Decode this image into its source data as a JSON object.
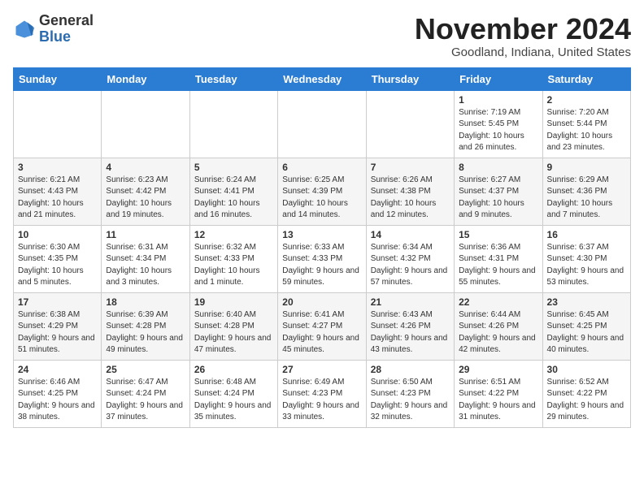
{
  "header": {
    "logo_general": "General",
    "logo_blue": "Blue",
    "month_title": "November 2024",
    "location": "Goodland, Indiana, United States"
  },
  "weekdays": [
    "Sunday",
    "Monday",
    "Tuesday",
    "Wednesday",
    "Thursday",
    "Friday",
    "Saturday"
  ],
  "weeks": [
    [
      {
        "day": "",
        "info": ""
      },
      {
        "day": "",
        "info": ""
      },
      {
        "day": "",
        "info": ""
      },
      {
        "day": "",
        "info": ""
      },
      {
        "day": "",
        "info": ""
      },
      {
        "day": "1",
        "info": "Sunrise: 7:19 AM\nSunset: 5:45 PM\nDaylight: 10 hours and 26 minutes."
      },
      {
        "day": "2",
        "info": "Sunrise: 7:20 AM\nSunset: 5:44 PM\nDaylight: 10 hours and 23 minutes."
      }
    ],
    [
      {
        "day": "3",
        "info": "Sunrise: 6:21 AM\nSunset: 4:43 PM\nDaylight: 10 hours and 21 minutes."
      },
      {
        "day": "4",
        "info": "Sunrise: 6:23 AM\nSunset: 4:42 PM\nDaylight: 10 hours and 19 minutes."
      },
      {
        "day": "5",
        "info": "Sunrise: 6:24 AM\nSunset: 4:41 PM\nDaylight: 10 hours and 16 minutes."
      },
      {
        "day": "6",
        "info": "Sunrise: 6:25 AM\nSunset: 4:39 PM\nDaylight: 10 hours and 14 minutes."
      },
      {
        "day": "7",
        "info": "Sunrise: 6:26 AM\nSunset: 4:38 PM\nDaylight: 10 hours and 12 minutes."
      },
      {
        "day": "8",
        "info": "Sunrise: 6:27 AM\nSunset: 4:37 PM\nDaylight: 10 hours and 9 minutes."
      },
      {
        "day": "9",
        "info": "Sunrise: 6:29 AM\nSunset: 4:36 PM\nDaylight: 10 hours and 7 minutes."
      }
    ],
    [
      {
        "day": "10",
        "info": "Sunrise: 6:30 AM\nSunset: 4:35 PM\nDaylight: 10 hours and 5 minutes."
      },
      {
        "day": "11",
        "info": "Sunrise: 6:31 AM\nSunset: 4:34 PM\nDaylight: 10 hours and 3 minutes."
      },
      {
        "day": "12",
        "info": "Sunrise: 6:32 AM\nSunset: 4:33 PM\nDaylight: 10 hours and 1 minute."
      },
      {
        "day": "13",
        "info": "Sunrise: 6:33 AM\nSunset: 4:33 PM\nDaylight: 9 hours and 59 minutes."
      },
      {
        "day": "14",
        "info": "Sunrise: 6:34 AM\nSunset: 4:32 PM\nDaylight: 9 hours and 57 minutes."
      },
      {
        "day": "15",
        "info": "Sunrise: 6:36 AM\nSunset: 4:31 PM\nDaylight: 9 hours and 55 minutes."
      },
      {
        "day": "16",
        "info": "Sunrise: 6:37 AM\nSunset: 4:30 PM\nDaylight: 9 hours and 53 minutes."
      }
    ],
    [
      {
        "day": "17",
        "info": "Sunrise: 6:38 AM\nSunset: 4:29 PM\nDaylight: 9 hours and 51 minutes."
      },
      {
        "day": "18",
        "info": "Sunrise: 6:39 AM\nSunset: 4:28 PM\nDaylight: 9 hours and 49 minutes."
      },
      {
        "day": "19",
        "info": "Sunrise: 6:40 AM\nSunset: 4:28 PM\nDaylight: 9 hours and 47 minutes."
      },
      {
        "day": "20",
        "info": "Sunrise: 6:41 AM\nSunset: 4:27 PM\nDaylight: 9 hours and 45 minutes."
      },
      {
        "day": "21",
        "info": "Sunrise: 6:43 AM\nSunset: 4:26 PM\nDaylight: 9 hours and 43 minutes."
      },
      {
        "day": "22",
        "info": "Sunrise: 6:44 AM\nSunset: 4:26 PM\nDaylight: 9 hours and 42 minutes."
      },
      {
        "day": "23",
        "info": "Sunrise: 6:45 AM\nSunset: 4:25 PM\nDaylight: 9 hours and 40 minutes."
      }
    ],
    [
      {
        "day": "24",
        "info": "Sunrise: 6:46 AM\nSunset: 4:25 PM\nDaylight: 9 hours and 38 minutes."
      },
      {
        "day": "25",
        "info": "Sunrise: 6:47 AM\nSunset: 4:24 PM\nDaylight: 9 hours and 37 minutes."
      },
      {
        "day": "26",
        "info": "Sunrise: 6:48 AM\nSunset: 4:24 PM\nDaylight: 9 hours and 35 minutes."
      },
      {
        "day": "27",
        "info": "Sunrise: 6:49 AM\nSunset: 4:23 PM\nDaylight: 9 hours and 33 minutes."
      },
      {
        "day": "28",
        "info": "Sunrise: 6:50 AM\nSunset: 4:23 PM\nDaylight: 9 hours and 32 minutes."
      },
      {
        "day": "29",
        "info": "Sunrise: 6:51 AM\nSunset: 4:22 PM\nDaylight: 9 hours and 31 minutes."
      },
      {
        "day": "30",
        "info": "Sunrise: 6:52 AM\nSunset: 4:22 PM\nDaylight: 9 hours and 29 minutes."
      }
    ]
  ]
}
